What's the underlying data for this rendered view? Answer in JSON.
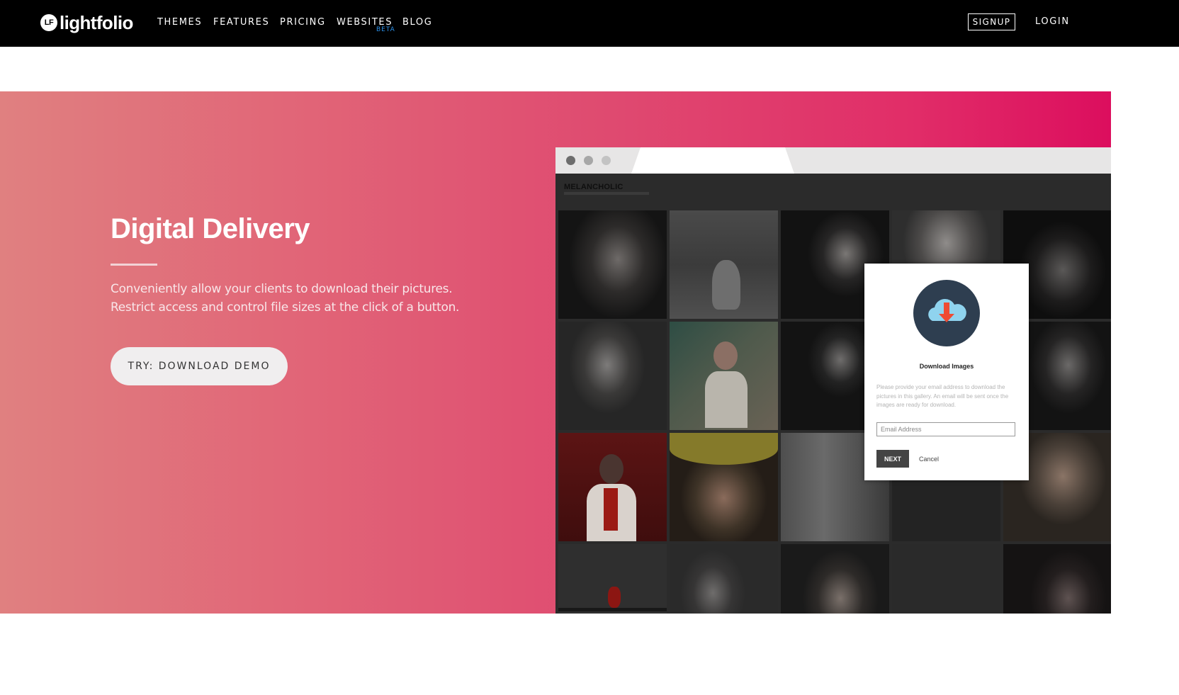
{
  "brand": {
    "logo_mark": "LF",
    "name": "lightfolio"
  },
  "nav": {
    "items": [
      {
        "label": "THEMES"
      },
      {
        "label": "FEATURES"
      },
      {
        "label": "PRICING"
      },
      {
        "label": "WEBSITES"
      },
      {
        "label": "BLOG"
      }
    ],
    "websites_badge": "BETA",
    "signup_label": "SIGNUP",
    "login_label": "LOGIN"
  },
  "hero": {
    "title": "Digital Delivery",
    "description_lines": [
      "Conveniently allow your clients to download their pictures.",
      "Restrict access and control file sizes at the click of a button."
    ],
    "cta_label": "TRY: DOWNLOAD DEMO"
  },
  "mockup": {
    "gallery_title": "MELANCHOLIC",
    "window_dots": [
      "close-dot",
      "minimize-dot",
      "maximize-dot"
    ],
    "dialog": {
      "icon": "cloud-download-icon",
      "title": "Download Images",
      "description": "Please provide your email address to download the pictures in this gallery. An email will be sent once the images are ready for download.",
      "email_placeholder": "Email Address",
      "next_label": "NEXT",
      "cancel_label": "Cancel"
    }
  },
  "colors": {
    "nav_background": "#000000",
    "hero_gradient_start": "#e08080",
    "hero_gradient_end": "#dc0e5e",
    "beta_badge": "#2a8fe8",
    "dialog_icon_circle": "#2e3e50",
    "dialog_icon_cloud": "#8fd3ee",
    "dialog_icon_arrow": "#ee4b33"
  }
}
